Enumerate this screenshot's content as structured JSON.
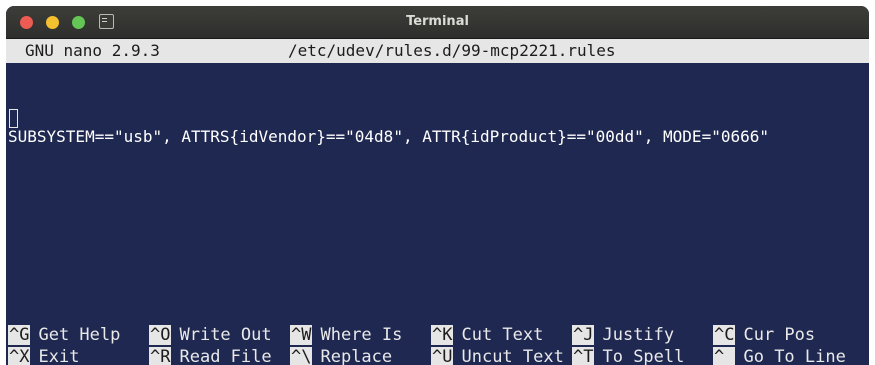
{
  "window": {
    "title": "Terminal"
  },
  "nano": {
    "version": "GNU nano 2.9.3",
    "filename": "/etc/udev/rules.d/99-mcp2221.rules"
  },
  "editor": {
    "lines": [
      "SUBSYSTEM==\"usb\", ATTRS{idVendor}==\"04d8\", ATTR{idProduct}==\"00dd\", MODE=\"0666\""
    ]
  },
  "shortcuts": {
    "row1": [
      {
        "key": "^G",
        "label": "Get Help"
      },
      {
        "key": "^O",
        "label": "Write Out"
      },
      {
        "key": "^W",
        "label": "Where Is"
      },
      {
        "key": "^K",
        "label": "Cut Text"
      },
      {
        "key": "^J",
        "label": "Justify"
      },
      {
        "key": "^C",
        "label": "Cur Pos"
      }
    ],
    "row2": [
      {
        "key": "^X",
        "label": "Exit"
      },
      {
        "key": "^R",
        "label": "Read File"
      },
      {
        "key": "^\\",
        "label": "Replace"
      },
      {
        "key": "^U",
        "label": "Uncut Text"
      },
      {
        "key": "^T",
        "label": "To Spell"
      },
      {
        "key": "^_",
        "label": "Go To Line"
      }
    ]
  }
}
